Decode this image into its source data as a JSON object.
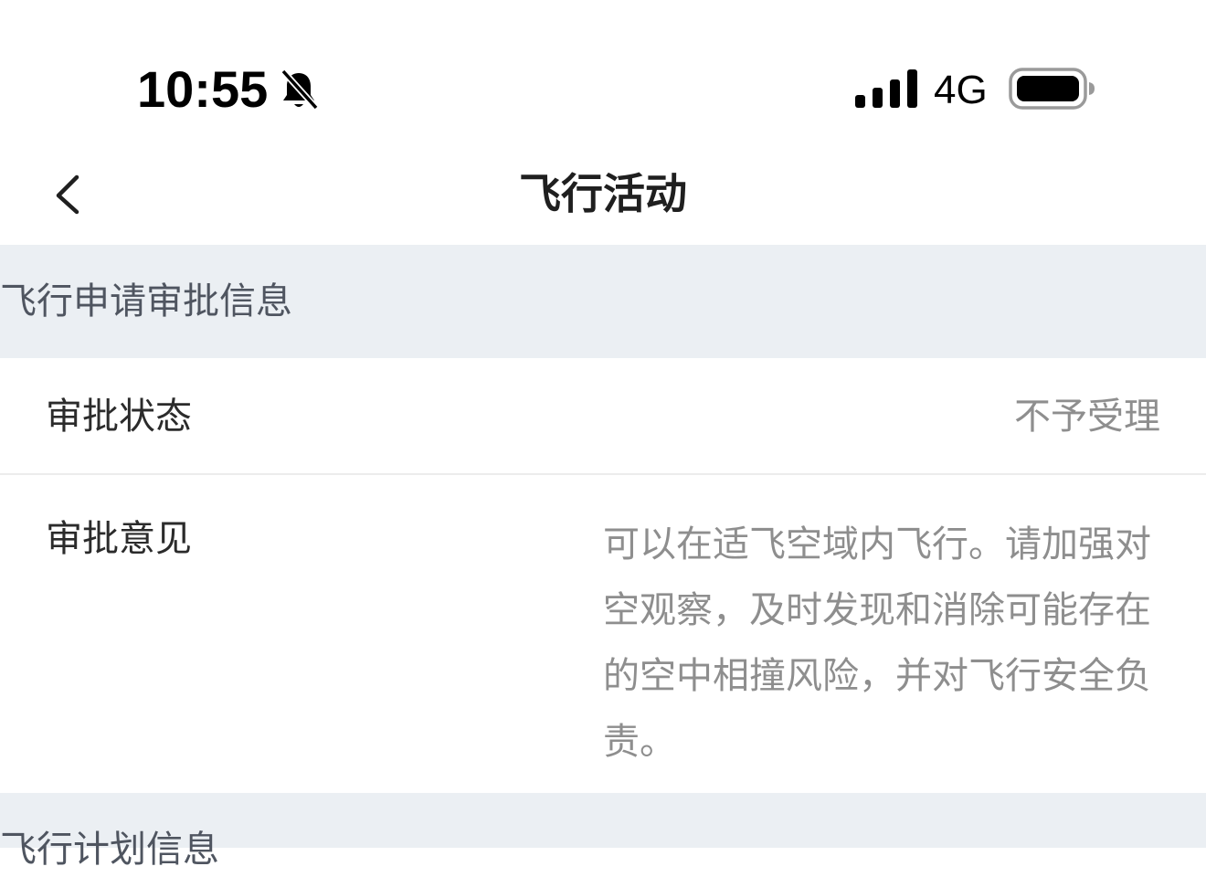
{
  "status_bar": {
    "time": "10:55",
    "network": "4G",
    "icons": [
      "bell-muted-icon",
      "signal-icon",
      "battery-icon"
    ]
  },
  "nav": {
    "back_icon": "chevron-left-icon",
    "title": "飞行活动"
  },
  "sections": [
    {
      "title": "飞行申请审批信息",
      "rows": [
        {
          "label": "审批状态",
          "value": "不予受理"
        },
        {
          "label": "审批意见",
          "value": "可以在适飞空域内飞行。请加强对空观察，及时发现和消除可能存在的空中相撞风险，并对飞行安全负责。"
        }
      ]
    },
    {
      "title": "飞行计划信息"
    }
  ],
  "colors": {
    "section_bg": "#ebeff3",
    "label_text": "#2b2b2b",
    "value_text": "#8e8e8e",
    "section_title_text": "#4f5560"
  }
}
